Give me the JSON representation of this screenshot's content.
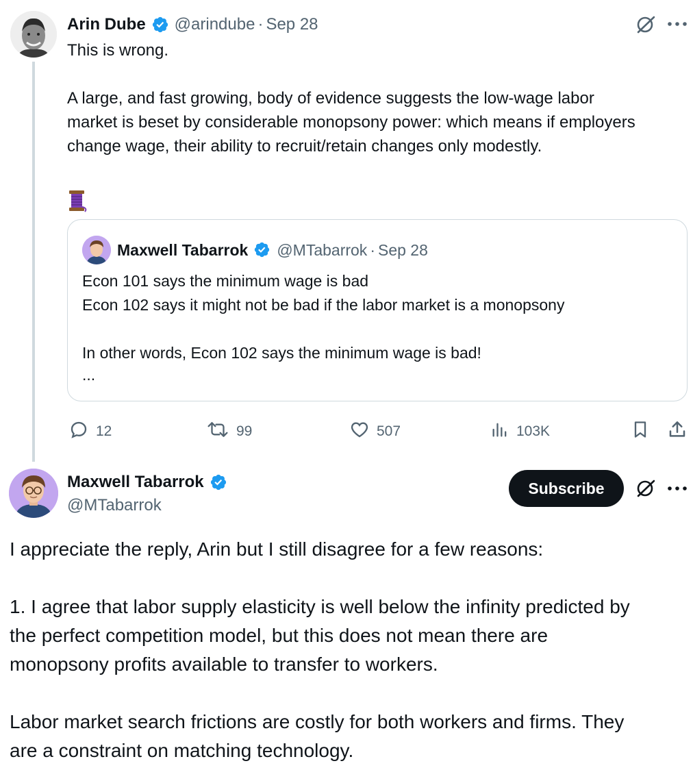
{
  "parent": {
    "author_name": "Arin Dube",
    "author_handle": "@arindube",
    "separator": "·",
    "date": "Sep 28",
    "lines": [
      "This is wrong.",
      "A large, and fast growing, body of evidence suggests the low-wage labor",
      "market is beset by considerable monopsony power: which means if employers",
      "change wage, their ability to recruit/retain changes only modestly."
    ],
    "thread_emoji": "🧵",
    "quoted": {
      "author_name": "Maxwell Tabarrok",
      "author_handle": "@MTabarrok",
      "separator": "·",
      "date": "Sep 28",
      "lines": [
        "Econ 101 says the minimum wage is bad",
        "Econ 102 says it might not be bad if the labor market is a monopsony",
        "In other words, Econ 102 says the minimum wage is bad!",
        "..."
      ]
    },
    "actions": {
      "replies": "12",
      "reposts": "99",
      "likes": "507",
      "views": "103K"
    }
  },
  "reply": {
    "author_name": "Maxwell Tabarrok",
    "author_handle": "@MTabarrok",
    "subscribe_label": "Subscribe",
    "lines": [
      "I appreciate the reply, Arin but I still disagree for a few reasons:",
      "1. I agree that labor supply elasticity is well below the infinity predicted by",
      "the perfect competition model, but this does not mean there are",
      "monopsony profits available to transfer to workers.",
      "Labor market search frictions are costly for both workers and firms. They",
      "are a constraint on matching technology."
    ]
  },
  "colors": {
    "verified_blue": "#1d9bf0",
    "text_primary": "#0f1419",
    "text_secondary": "#536471",
    "border": "#cfd9de"
  },
  "icons": [
    "grok-icon",
    "more-icon",
    "reply-icon",
    "repost-icon",
    "like-icon",
    "views-icon",
    "bookmark-icon",
    "share-icon",
    "verified-icon"
  ]
}
